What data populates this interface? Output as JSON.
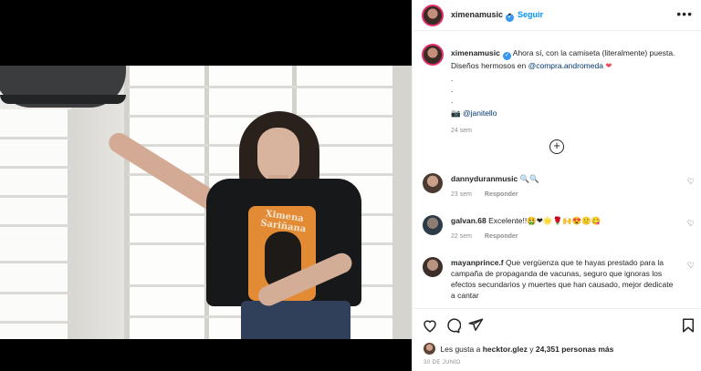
{
  "header": {
    "username": "ximenamusic",
    "follow_label": "Seguir",
    "separator": "•",
    "more_icon": "more-horizontal-icon"
  },
  "caption": {
    "username": "ximenamusic",
    "text_part1": "Ahora sí, con la camiseta (literalmente) puesta. Diseños hermosos en",
    "mention1": "@compra.andromeda",
    "emoji1": "❤",
    "dot1": ".",
    "dot2": ".",
    "dot3": ".",
    "camera_emoji": "📷",
    "mention2": "@janitello",
    "time": "24 sem"
  },
  "load_more_icon": "plus-circle-icon",
  "comments": [
    {
      "username": "dannyduranmusic",
      "text": "🔍🔍",
      "time": "23 sem",
      "reply_label": "Responder"
    },
    {
      "username": "galvan.68",
      "text": "Excelente!!🤮❤🌟🌹🙌😍🙂😋",
      "time": "22 sem",
      "reply_label": "Responder"
    },
    {
      "username": "mayanprince.f",
      "text": "Que vergüenza que te hayas prestado para la campaña de propaganda de vacunas, seguro que ignoras los efectos secundarios y muertes que han causado, mejor dedicate a cantar"
    }
  ],
  "likes": {
    "prefix": "Les gusta a",
    "user": "hecktor.glez",
    "connector": "y",
    "count": "24,351 personas más"
  },
  "date": "30 DE JUNIO",
  "photo": {
    "shirt_text_line1": "Ximena",
    "shirt_text_line2": "Sariñana"
  },
  "colors": {
    "follow": "#0095f6",
    "mention": "#00376b",
    "muted": "#8e8e8e",
    "verified": "#3897f0"
  }
}
